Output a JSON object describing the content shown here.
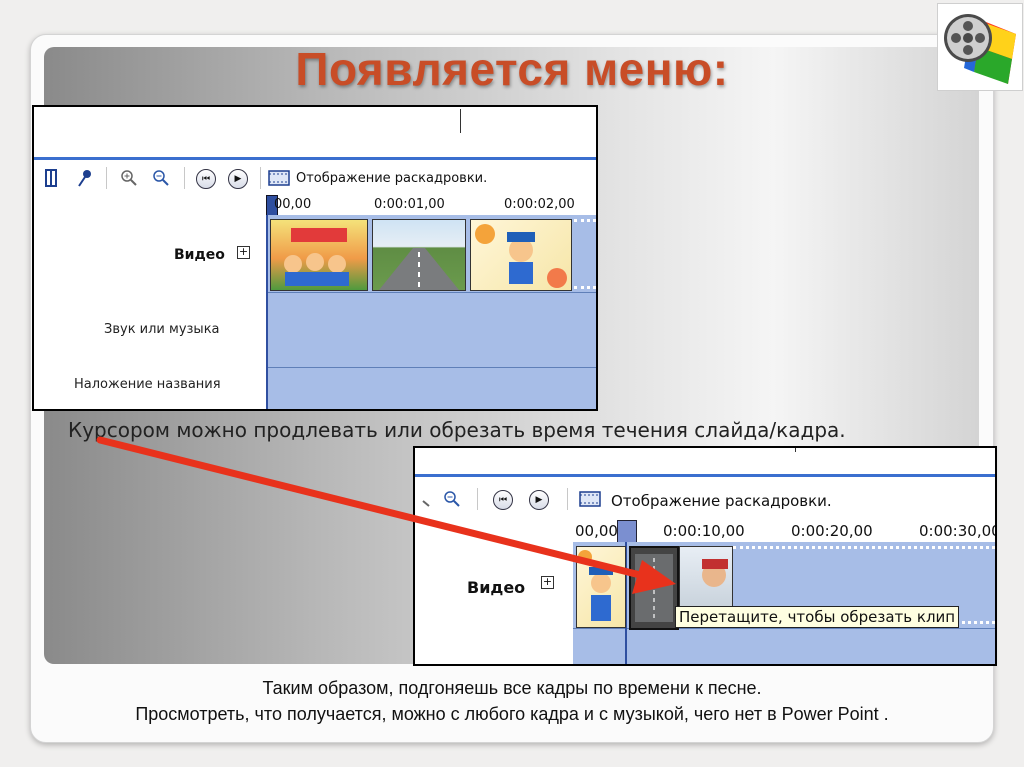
{
  "slide": {
    "title": "Появляется меню:",
    "caption": "Курсором можно продлевать или обрезать время течения слайда/кадра.",
    "bottom_line1": "Таким образом, подгоняешь все кадры по времени к песне.",
    "bottom_line2": "Просмотреть, что получается, можно с любого кадра и с музыкой, чего нет в Power Point ."
  },
  "shot1": {
    "toolbar_label": "Отображение раскадровки.",
    "ruler": [
      "00,00",
      "0:00:01,00",
      "0:00:02,00"
    ],
    "track_video": "Видео",
    "track_audio": "Звук или музыка",
    "track_title": "Наложение названия",
    "expand": "+"
  },
  "shot2": {
    "toolbar_label": "Отображение раскадровки.",
    "ruler": [
      "00,00",
      "0:00:10,00",
      "0:00:20,00",
      "0:00:30,00"
    ],
    "track_video": "Видео",
    "expand": "+",
    "tooltip": "Перетащите, чтобы обрезать клип"
  },
  "icons": {
    "play": "▶",
    "prev": "⏮",
    "zoom_in": "⊕",
    "zoom_out": "⊖"
  },
  "colors": {
    "title": "#c84d27",
    "arrow": "#e8321c",
    "track": "#a7bde7",
    "toolbar_line": "#3b6fcf"
  }
}
